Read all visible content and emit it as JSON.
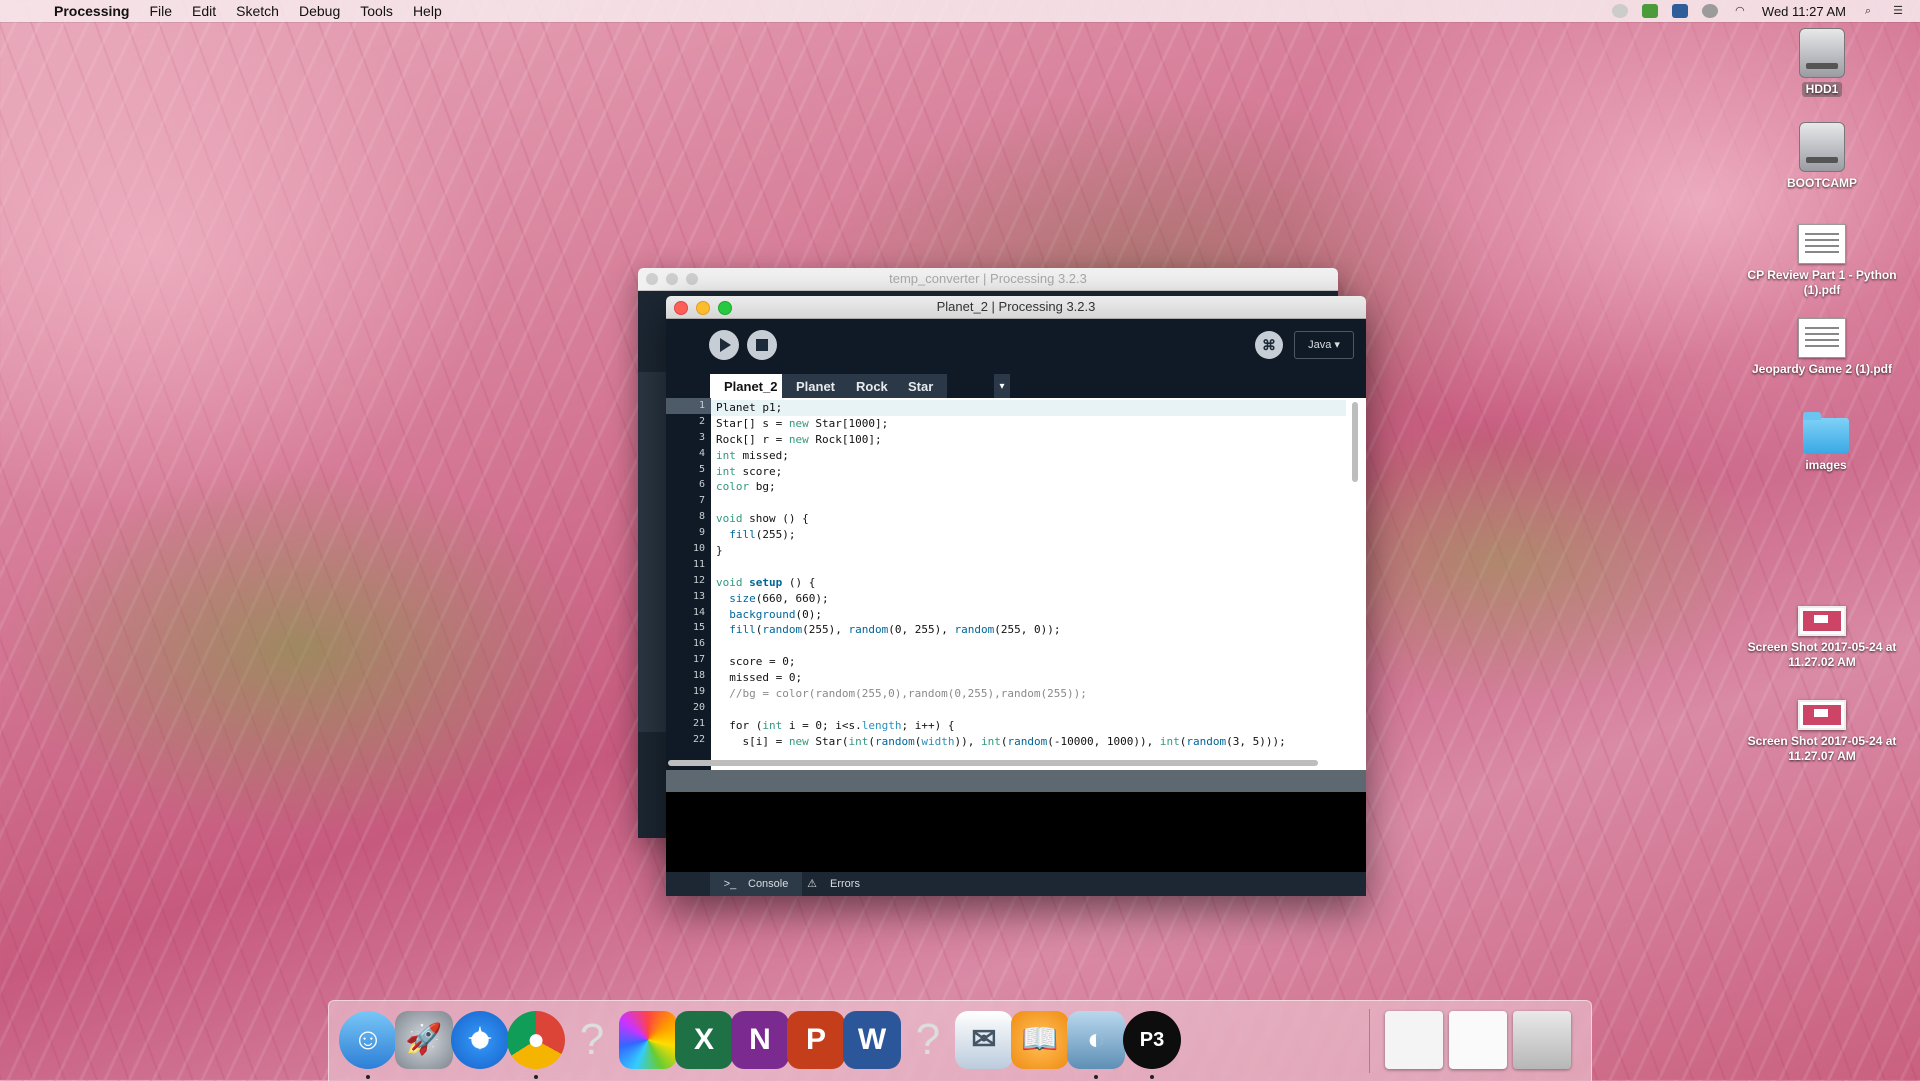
{
  "menubar": {
    "app_name": "Processing",
    "items": [
      "File",
      "Edit",
      "Sketch",
      "Debug",
      "Tools",
      "Help"
    ],
    "clock": "Wed 11:27 AM"
  },
  "desktop_icons": [
    {
      "label": "HDD1",
      "kind": "disk"
    },
    {
      "label": "BOOTCAMP",
      "kind": "disk"
    },
    {
      "label": "CP Review Part 1 - Python (1).pdf",
      "kind": "pdf"
    },
    {
      "label": "Jeopardy Game 2 (1).pdf",
      "kind": "pdf"
    },
    {
      "label": "images",
      "kind": "folder"
    },
    {
      "label": "Screen Shot 2017-05-24 at 11.27.02 AM",
      "kind": "screenshot"
    },
    {
      "label": "Screen Shot 2017-05-24 at 11.27.07 AM",
      "kind": "screenshot"
    }
  ],
  "back_window": {
    "title": "temp_converter | Processing 3.2.3"
  },
  "front_window": {
    "title": "Planet_2 | Processing 3.2.3",
    "mode": "Java ▾",
    "tabs": [
      "Planet_2",
      "Planet",
      "Rock",
      "Star"
    ],
    "tabs_more": "▾",
    "active_tab": "Planet_2",
    "line_numbers": [
      "1",
      "2",
      "3",
      "4",
      "5",
      "6",
      "7",
      "8",
      "9",
      "10",
      "11",
      "12",
      "13",
      "14",
      "15",
      "16",
      "17",
      "18",
      "19",
      "20",
      "21",
      "22"
    ],
    "code_lines": [
      "Planet p1;",
      "Star[] s = new Star[1000];",
      "Rock[] r = new Rock[100];",
      "int missed;",
      "int score;",
      "color bg;",
      "",
      "void show () {",
      "  fill(255);",
      "}",
      "",
      "void setup () {",
      "  size(660, 660);",
      "  background(0);",
      "  fill(random(255), random(0, 255), random(255, 0));",
      "",
      "  score = 0;",
      "  missed = 0;",
      "  //bg = color(random(255,0),random(0,255),random(255));",
      "",
      "  for (int i = 0; i<s.length; i++) {",
      "    s[i] = new Star(int(random(width)), int(random(-10000, 1000)), int(random(3, 5)));"
    ],
    "console_tab": "Console",
    "errors_tab": "Errors"
  },
  "dock": {
    "apps": [
      "Finder",
      "Launchpad",
      "Safari",
      "Chrome",
      "Unknown",
      "Photos",
      "Excel",
      "OneNote",
      "PowerPoint",
      "Word",
      "Unknown",
      "Preview",
      "iBooks",
      "Image Capture",
      "Processing",
      "Screen Shot",
      "Downloads",
      "Trash"
    ]
  },
  "colors": {
    "ide_dark": "#0f1a26",
    "keyword_blue": "#33997e",
    "tab_active_bg": "#ffffff"
  }
}
